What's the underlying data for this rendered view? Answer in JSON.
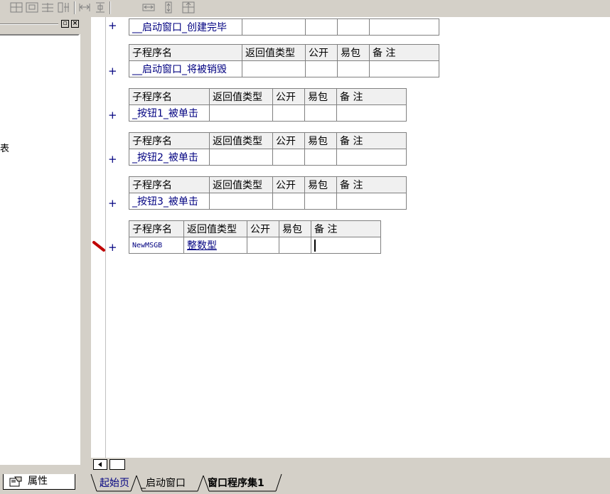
{
  "toolbar": {
    "icons": [
      "split-cells-icon",
      "merge-rows-icon",
      "merge-columns-icon",
      "insert-column-icon",
      "fit-width-icon",
      "fit-height-icon",
      "expand-width-icon",
      "expand-height-icon",
      "grid-icon"
    ]
  },
  "left_panel": {
    "fragment_text": "表",
    "properties_tab": "属性"
  },
  "editor": {
    "headers": {
      "name": "子程序名",
      "return_type": "返回值类型",
      "public": "公开",
      "easy_package": "易包",
      "remark": "备 注"
    },
    "subroutines": [
      {
        "name": "__启动窗口_创建完毕"
      },
      {
        "name": "__启动窗口_将被销毁"
      },
      {
        "name": "_按钮1_被单击"
      },
      {
        "name": "_按钮2_被单击"
      },
      {
        "name": "_按钮3_被单击"
      },
      {
        "name": "NewMSGB",
        "return_type": "整数型"
      }
    ],
    "plus": "+"
  },
  "tabs": [
    "起始页",
    "_启动窗口",
    "窗口程序集1"
  ],
  "colors": {
    "chrome": "#d4d0c8",
    "header_bg": "#f0f0f0",
    "link": "#000080",
    "marker": "#c00000"
  }
}
